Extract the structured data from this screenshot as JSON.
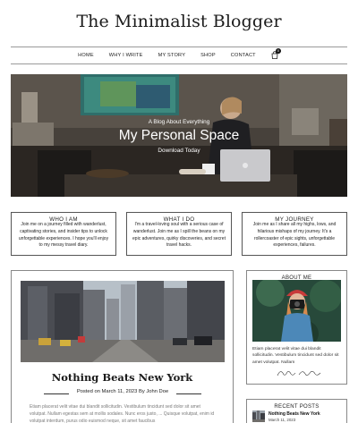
{
  "site": {
    "title": "The Minimalist Blogger"
  },
  "nav": {
    "items": [
      "HOME",
      "WHY I WRITE",
      "MY STORY",
      "SHOP",
      "CONTACT"
    ],
    "cart_count": "0"
  },
  "hero": {
    "pretitle": "A Blog About Everything",
    "title": "My Personal Space",
    "link": "Download Today"
  },
  "features": [
    {
      "title": "WHO I AM",
      "text": "Join me on a journey filled with wanderlust, captivating stories, and insider tips to unlock unforgettable experiences. I hope you'll enjoy to my messy travel diary."
    },
    {
      "title": "WHAT I DO",
      "text": "I'm a travel-loving soul with a serious case of wanderlust. Join me as I spill the beans on my epic adventures, quirky discoveries, and secret travel hacks."
    },
    {
      "title": "MY JOURNEY",
      "text": "Join me as I share all my highs, lows, and hilarious mishaps of my journey. It's a rollercoaster of epic sights, unforgettable experiences, failures."
    }
  ],
  "post": {
    "title": "Nothing Beats New York",
    "meta": "Posted on March 11, 2023 By John Doe",
    "excerpt": "Etiam placerat velit vitae dui blandit sollicitudin. Vestibulum tincidunt sed dolor sit amet volutpat. Nullam egestas sem at mollis sodales. Nunc eros justo, ... Quisque volutpat, enim id volutpat interdum, purus odio euismod neque, sit amet faucibus"
  },
  "sidebar": {
    "about": {
      "title": "ABOUT ME",
      "text": "Etiam placerat velit vitae dui blandit sollicitudin. Vestibulum tincidunt sed dolor sit amet volutpat. Nullam"
    },
    "recent": {
      "title": "RECENT POSTS",
      "items": [
        {
          "title": "Nothing Beats New York",
          "date": "March 11, 2023"
        }
      ]
    }
  },
  "colors": {
    "text": "#222222",
    "border": "#888888",
    "excerpt": "#7a7a7a"
  }
}
